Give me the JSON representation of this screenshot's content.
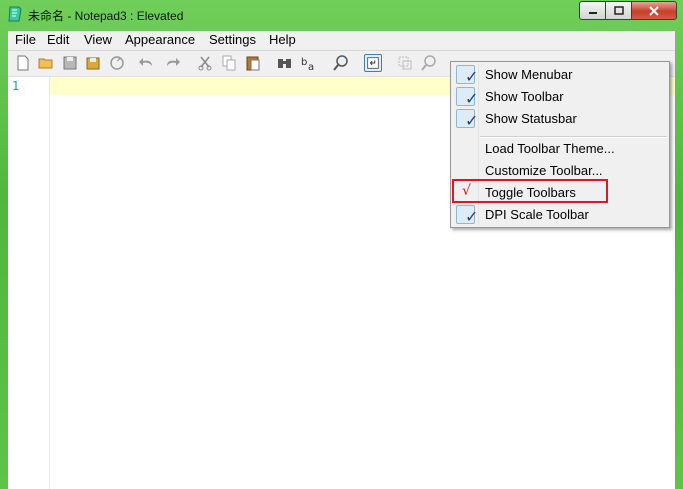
{
  "window": {
    "title": "未命名 - Notepad3 : Elevated"
  },
  "menubar": [
    {
      "label": "File"
    },
    {
      "label": "Edit"
    },
    {
      "label": "View"
    },
    {
      "label": "Appearance"
    },
    {
      "label": "Settings"
    },
    {
      "label": "Help"
    }
  ],
  "toolbar": {
    "buttons": [
      "new-file-icon",
      "open-folder-icon",
      "save-icon",
      "save-as-icon",
      "revert-icon",
      "undo-icon",
      "redo-icon",
      "cut-icon",
      "copy-icon",
      "paste-icon",
      "find-icon",
      "replace-icon",
      "zoom-find-icon",
      "word-wrap-icon",
      "select-icon",
      "zoom-icon",
      "favorite-icon",
      "star-icon",
      "zoom-in-icon",
      "zoom-out-icon",
      "scheme-icon",
      "settings-icon",
      "edit-icon",
      "exit-icon"
    ],
    "pressed": "word-wrap-icon"
  },
  "editor": {
    "line_number": "1",
    "current_line_color": "#ffffcc"
  },
  "context_menu": {
    "items": [
      {
        "label": "Show Menubar",
        "checked": true
      },
      {
        "label": "Show Toolbar",
        "checked": true
      },
      {
        "label": "Show Statusbar",
        "checked": true
      },
      {
        "label": "Load Toolbar Theme...",
        "checked": false
      },
      {
        "label": "Customize Toolbar...",
        "checked": false
      },
      {
        "label": "Toggle Toolbars",
        "checked": true,
        "highlighted": true
      },
      {
        "label": "DPI Scale Toolbar",
        "checked": true
      }
    ]
  },
  "colors": {
    "frame": "#5cc447",
    "highlight_border": "#e0181a",
    "check": "#1f3f8a"
  }
}
